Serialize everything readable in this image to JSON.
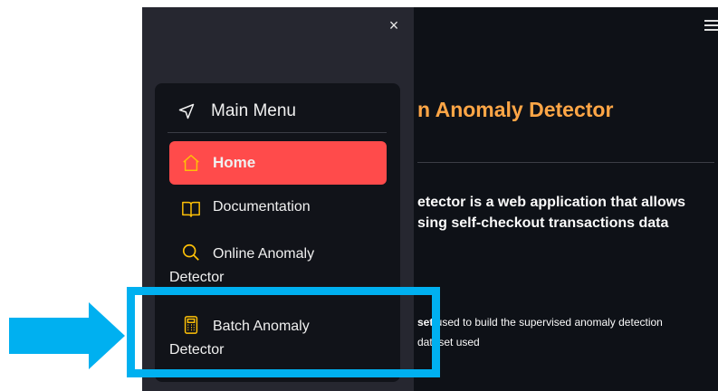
{
  "sidebar": {
    "close_icon": "×",
    "menu_title": "Main Menu",
    "items": [
      {
        "label": "Home",
        "icon": "home-icon",
        "active": true
      },
      {
        "label": "Documentation",
        "icon": "book-icon"
      },
      {
        "label_line1": "Online Anomaly",
        "label_line2": "Detector",
        "icon": "search-icon"
      },
      {
        "label_line1": "Batch Anomaly",
        "label_line2": "Detector",
        "icon": "calculator-icon"
      }
    ]
  },
  "main": {
    "title": "n Anomaly Detector",
    "description_line1": "etector is a web application that allows",
    "description_line2": "sing self-checkout transactions data",
    "para_line1_bold": "set",
    "para_line1_rest": " used to build the supervised anomaly detection",
    "para_line2": " dataset used"
  },
  "colors": {
    "accent": "#ff4b4b",
    "title": "#ffa646",
    "highlight": "#00b0f0",
    "background": "#0e1117",
    "sidebar": "#262730"
  }
}
